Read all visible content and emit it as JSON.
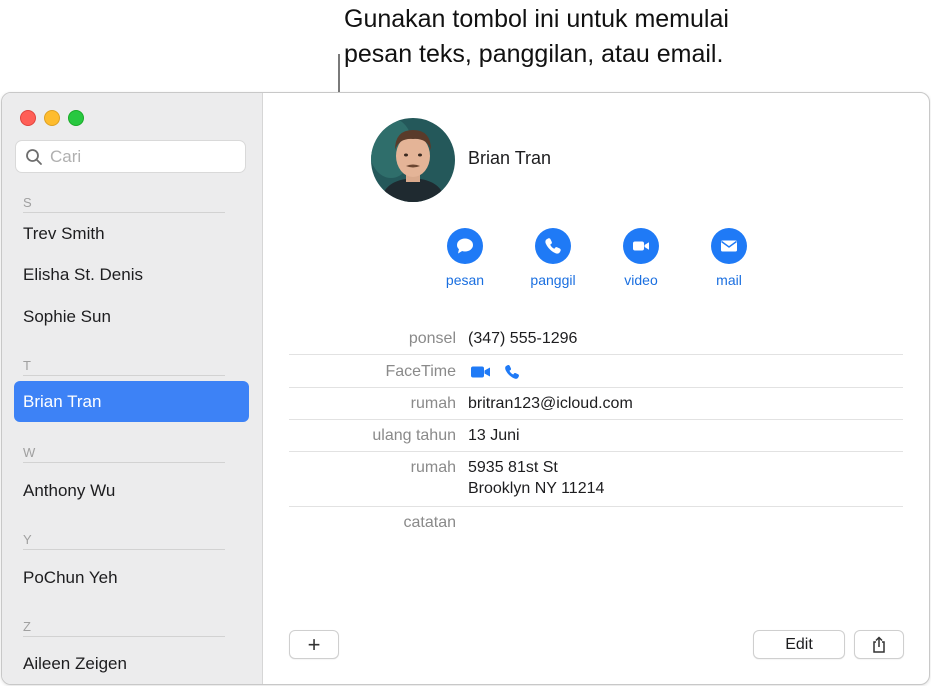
{
  "callout": {
    "line1": "Gunakan tombol ini untuk memulai",
    "line2": "pesan teks, panggilan, atau email."
  },
  "search": {
    "placeholder": "Cari"
  },
  "sidebar": {
    "sections": [
      {
        "letter": "S",
        "contacts": [
          "Trev Smith",
          "Elisha St. Denis",
          "Sophie Sun"
        ]
      },
      {
        "letter": "T",
        "contacts": [
          "Brian Tran"
        ]
      },
      {
        "letter": "W",
        "contacts": [
          "Anthony Wu"
        ]
      },
      {
        "letter": "Y",
        "contacts": [
          "PoChun Yeh"
        ]
      },
      {
        "letter": "Z",
        "contacts": [
          "Aileen Zeigen"
        ]
      }
    ],
    "selected": "Brian Tran"
  },
  "contact": {
    "name": "Brian Tran",
    "actions": [
      {
        "label": "pesan",
        "icon": "message-icon"
      },
      {
        "label": "panggil",
        "icon": "phone-icon"
      },
      {
        "label": "video",
        "icon": "video-icon"
      },
      {
        "label": "mail",
        "icon": "mail-icon"
      }
    ],
    "fields": [
      {
        "label": "ponsel",
        "value": "(347) 555-1296"
      },
      {
        "label": "FaceTime",
        "icons": [
          "video-icon",
          "phone-icon"
        ]
      },
      {
        "label": "rumah",
        "value": "britran123@icloud.com"
      },
      {
        "label": "ulang tahun",
        "value": "13 Juni"
      },
      {
        "label": "rumah",
        "value_line1": "5935 81st St",
        "value_line2": "Brooklyn NY 11214"
      },
      {
        "label": "catatan",
        "value": ""
      }
    ]
  },
  "footer": {
    "add_label": "+",
    "edit_label": "Edit",
    "share_icon": "share-icon"
  },
  "colors": {
    "accent": "#1f7af6",
    "selection": "#3d82f6",
    "sidebar_bg": "#ececed"
  }
}
